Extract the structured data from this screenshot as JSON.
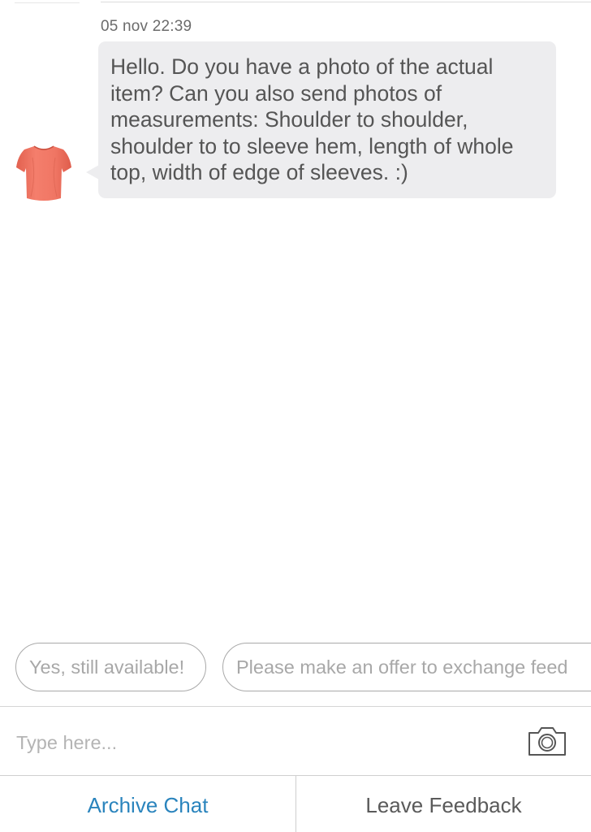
{
  "conversation": {
    "timestamp": "05 nov 22:39",
    "message": {
      "text": "Hello. Do you have a photo of the actual item? Can you also send photos of measurements: Shoulder to shoulder, shoulder to to sleeve hem, length of whole top, width of edge of sleeves. :)",
      "sender_avatar_icon": "coral-tshirt-icon"
    }
  },
  "quick_replies": [
    {
      "label": "Yes, still available!"
    },
    {
      "label": "Please make an offer to exchange feed"
    }
  ],
  "composer": {
    "placeholder": "Type here...",
    "value": "",
    "camera_icon": "camera-icon"
  },
  "bottom_bar": {
    "archive_label": "Archive Chat",
    "feedback_label": "Leave Feedback"
  },
  "colors": {
    "accent": "#2a84bd",
    "bubble": "#ededef",
    "avatar": "#f07a6a"
  }
}
